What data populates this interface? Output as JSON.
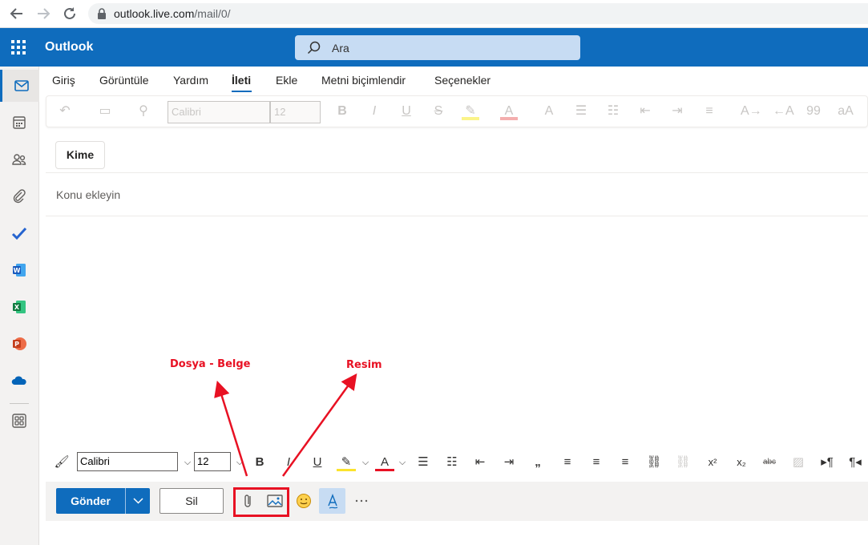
{
  "browser": {
    "url_domain": "outlook.live.com",
    "url_path": "/mail/0/"
  },
  "header": {
    "app_title": "Outlook",
    "search_placeholder": "Ara"
  },
  "tabs": [
    {
      "label": "Giriş"
    },
    {
      "label": "Görüntüle"
    },
    {
      "label": "Yardım"
    },
    {
      "label": "İleti",
      "active": true
    },
    {
      "label": "Ekle"
    },
    {
      "label": "Metni biçimlendir"
    },
    {
      "label": "Seçenekler"
    }
  ],
  "ribbon": {
    "font": "Calibri",
    "size": "12"
  },
  "compose": {
    "to_label": "Kime",
    "subject_placeholder": "Konu ekleyin"
  },
  "format_bar": {
    "font": "Calibri",
    "size": "12"
  },
  "actions": {
    "send_label": "Gönder",
    "discard_label": "Sil"
  },
  "annotations": {
    "file_label": "Dosya - Belge",
    "image_label": "Resim"
  },
  "colors": {
    "brand": "#0f6cbd",
    "annotation": "#e81123"
  }
}
